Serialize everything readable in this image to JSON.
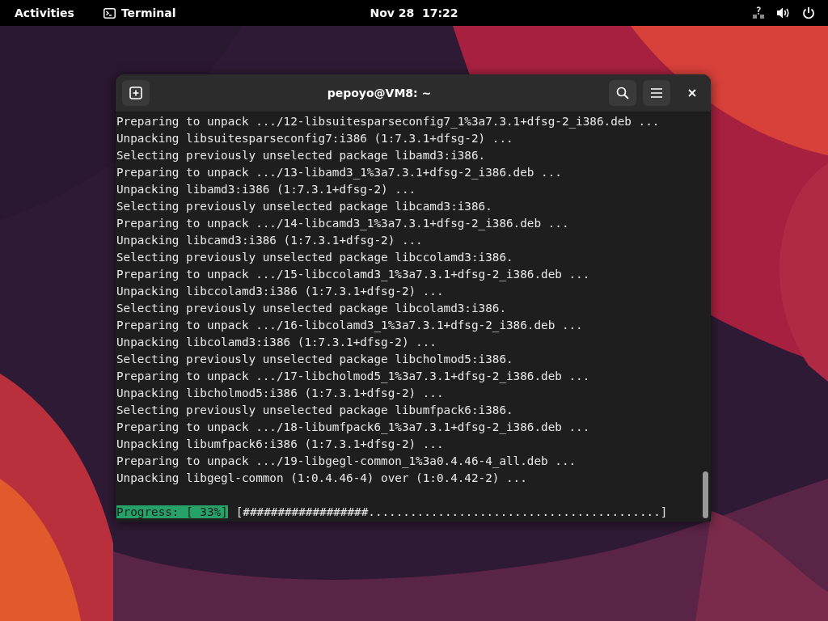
{
  "top_bar": {
    "activities": "Activities",
    "app": {
      "label": "Terminal"
    },
    "clock": "Nov 28  17:22"
  },
  "window": {
    "title": "pepoyo@VM8: ~",
    "lines": [
      "Preparing to unpack .../12-libsuitesparseconfig7_1%3a7.3.1+dfsg-2_i386.deb ...",
      "Unpacking libsuitesparseconfig7:i386 (1:7.3.1+dfsg-2) ...",
      "Selecting previously unselected package libamd3:i386.",
      "Preparing to unpack .../13-libamd3_1%3a7.3.1+dfsg-2_i386.deb ...",
      "Unpacking libamd3:i386 (1:7.3.1+dfsg-2) ...",
      "Selecting previously unselected package libcamd3:i386.",
      "Preparing to unpack .../14-libcamd3_1%3a7.3.1+dfsg-2_i386.deb ...",
      "Unpacking libcamd3:i386 (1:7.3.1+dfsg-2) ...",
      "Selecting previously unselected package libccolamd3:i386.",
      "Preparing to unpack .../15-libccolamd3_1%3a7.3.1+dfsg-2_i386.deb ...",
      "Unpacking libccolamd3:i386 (1:7.3.1+dfsg-2) ...",
      "Selecting previously unselected package libcolamd3:i386.",
      "Preparing to unpack .../16-libcolamd3_1%3a7.3.1+dfsg-2_i386.deb ...",
      "Unpacking libcolamd3:i386 (1:7.3.1+dfsg-2) ...",
      "Selecting previously unselected package libcholmod5:i386.",
      "Preparing to unpack .../17-libcholmod5_1%3a7.3.1+dfsg-2_i386.deb ...",
      "Unpacking libcholmod5:i386 (1:7.3.1+dfsg-2) ...",
      "Selecting previously unselected package libumfpack6:i386.",
      "Preparing to unpack .../18-libumfpack6_1%3a7.3.1+dfsg-2_i386.deb ...",
      "Unpacking libumfpack6:i386 (1:7.3.1+dfsg-2) ...",
      "Preparing to unpack .../19-libgegl-common_1%3a0.4.46-4_all.deb ...",
      "Unpacking libgegl-common (1:0.4.46-4) over (1:0.4.42-2) ..."
    ],
    "progress": {
      "label": "Progress: [ 33%]",
      "bar": "[##################..........................................]"
    }
  }
}
